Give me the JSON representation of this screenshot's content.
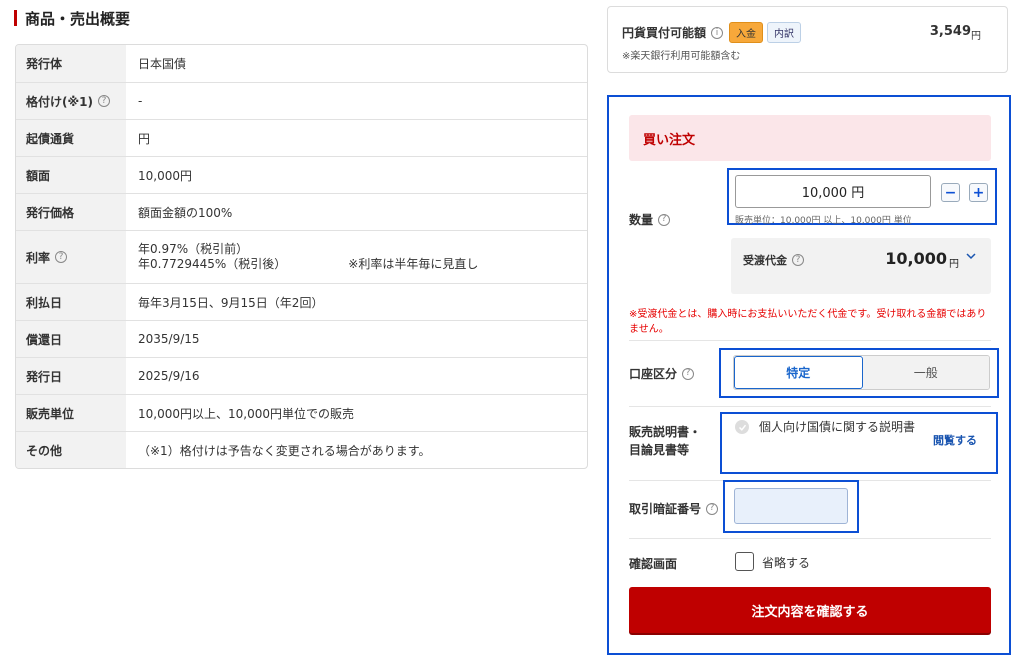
{
  "section_title": "商品・売出概要",
  "spec_rows": [
    {
      "label": "発行体",
      "value": "日本国債"
    },
    {
      "label": "格付け(※1)",
      "value": "-"
    },
    {
      "label": "起債通貨",
      "value": "円"
    },
    {
      "label": "額面",
      "value": "10,000円"
    },
    {
      "label": "発行価格",
      "value": "額面金額の100%"
    },
    {
      "label": "利率",
      "value_line1": "年0.97%（税引前）",
      "value_line2": "年0.7729445%（税引後）",
      "note": "※利率は半年毎に見直し"
    },
    {
      "label": "利払日",
      "value": "毎年3月15日、9月15日（年2回）"
    },
    {
      "label": "償還日",
      "value": "2035/9/15"
    },
    {
      "label": "発行日",
      "value": "2025/9/16"
    },
    {
      "label": "販売単位",
      "value": "10,000円以上、10,000円単位での販売"
    },
    {
      "label": "その他",
      "value": "（※1）格付けは予告なく変更される場合があります。"
    }
  ],
  "cash": {
    "label": "円貨買付可能額",
    "deposit_button": "入金",
    "detail_button": "内訳",
    "amount": "3,549",
    "unit": "円",
    "note": "※楽天銀行利用可能額含む"
  },
  "order": {
    "header": "買い注文",
    "quantity": {
      "label": "数量",
      "value": "10,000 円",
      "minus": "−",
      "plus": "+",
      "hint": "販売単位：10,000円 以上、10,000円 単位"
    },
    "cost": {
      "label": "受渡代金",
      "amount": "10,000",
      "unit": "円"
    },
    "cost_note": "※受渡代金とは、購入時にお支払いいただく代金です。受け取れる金額ではありません。",
    "account": {
      "label": "口座区分",
      "options": [
        "特定",
        "一般"
      ],
      "selected": "特定"
    },
    "docs": {
      "label_line1": "販売説明書・",
      "label_line2": "目論見書等",
      "doc_name": "個人向け国債に関する説明書",
      "link": "閲覧する"
    },
    "pin": {
      "label": "取引暗証番号",
      "value": ""
    },
    "confirm": {
      "label": "確認画面",
      "option": "省略する",
      "checked": false
    },
    "submit": "注文内容を確認する"
  },
  "colors": {
    "brand_red": "#bf0000",
    "highlight_blue": "#0c4fd4",
    "order_header_bg": "#fbe6e9"
  }
}
